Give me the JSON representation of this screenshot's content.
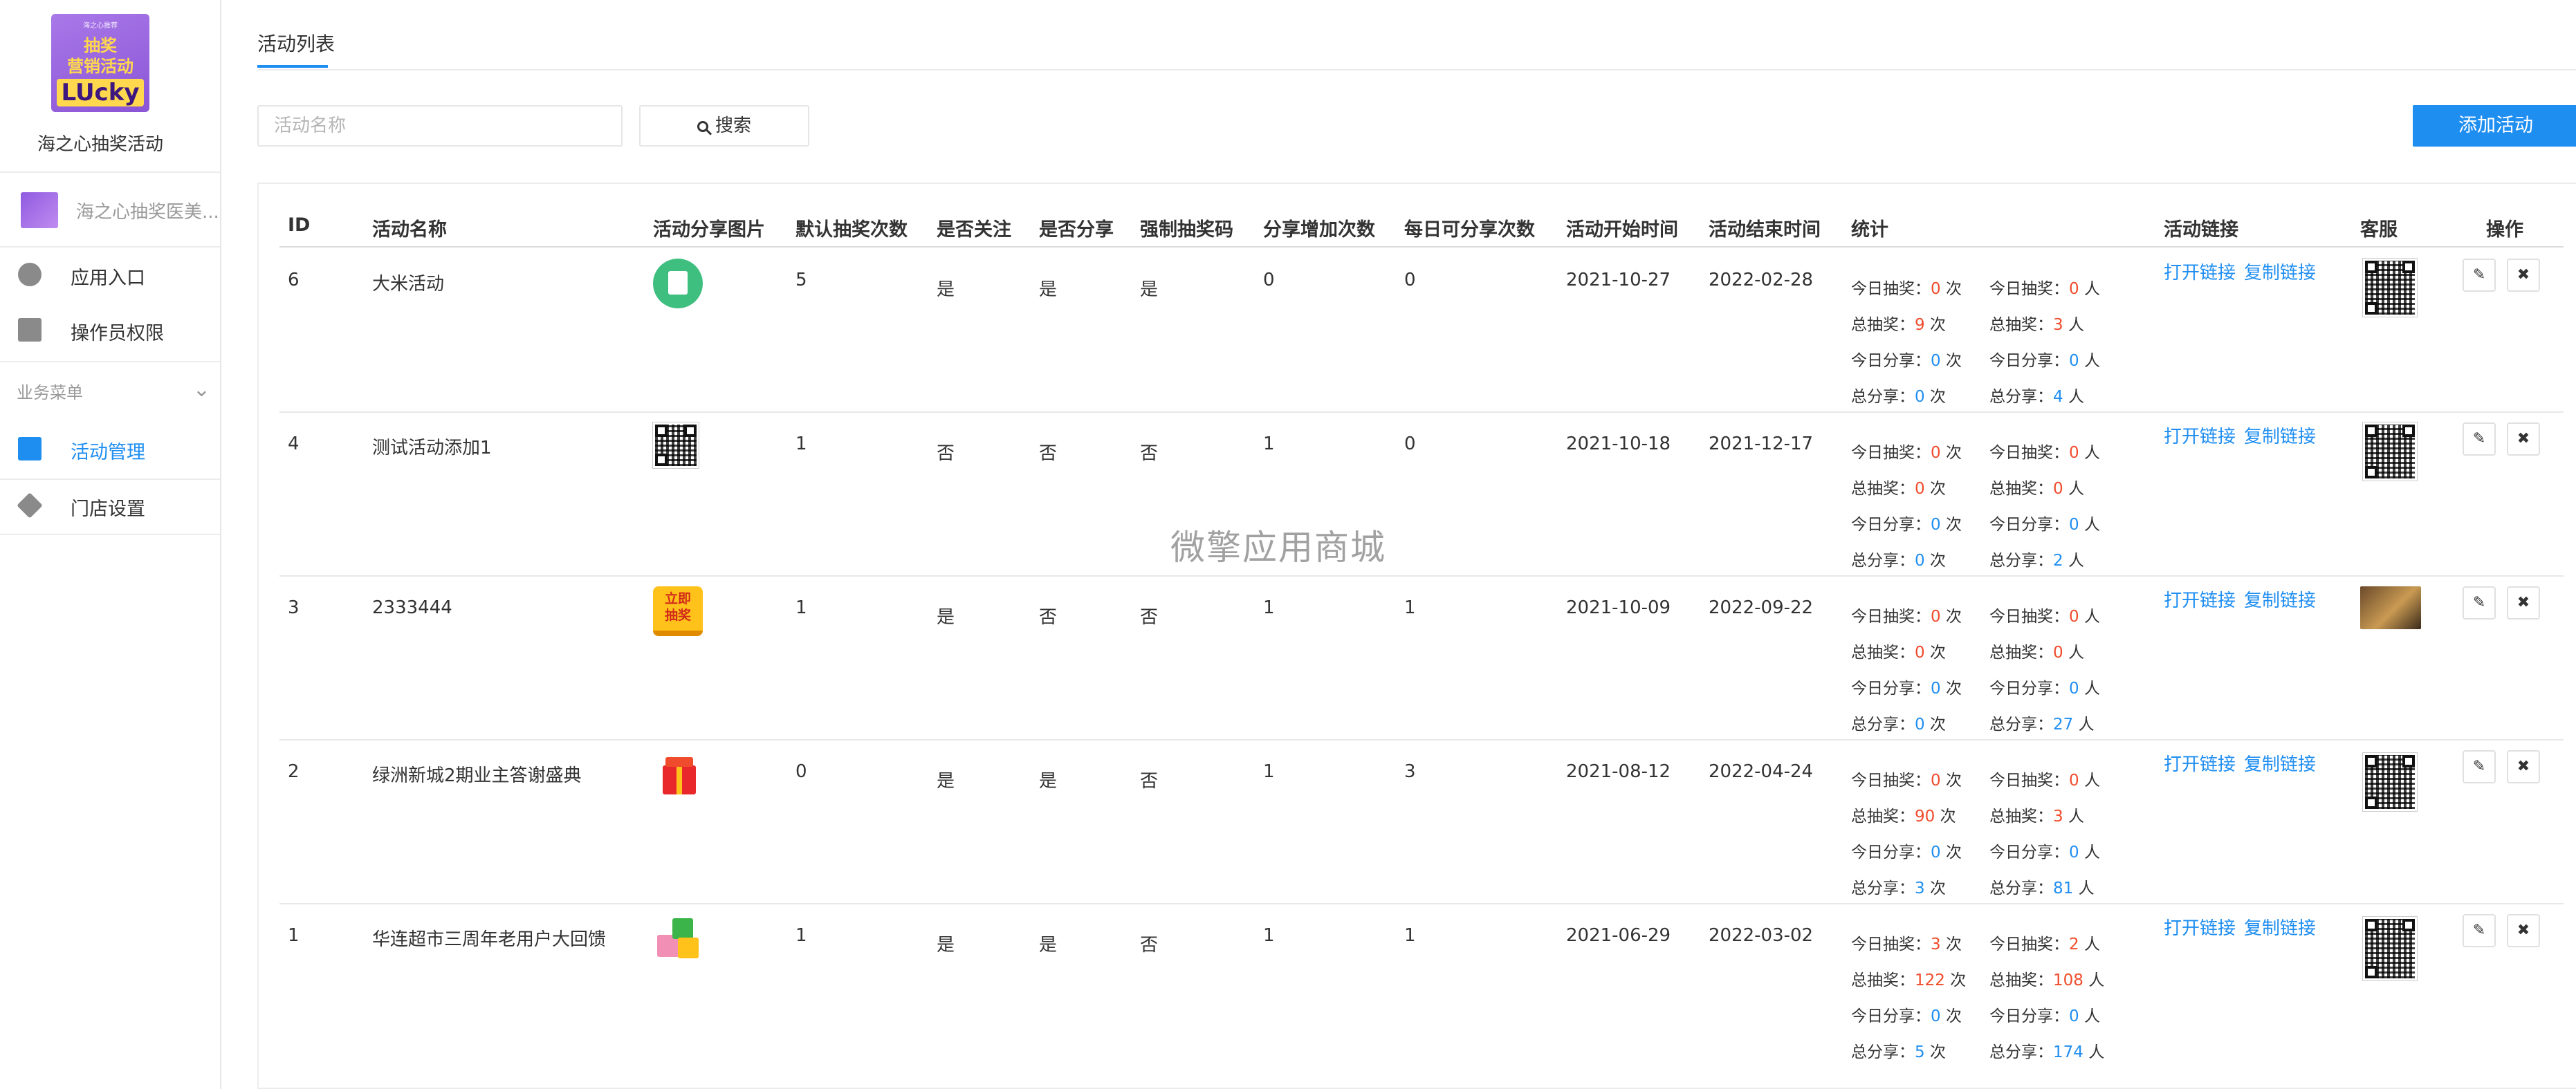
{
  "sidebar": {
    "logo": {
      "line1": "海之心推荐",
      "line2": "抽奖",
      "line3": "营销活动",
      "line4": "LUcky"
    },
    "app_name": "海之心抽奖活动",
    "store_name": "海之心抽奖医美...",
    "items": [
      {
        "label": "应用入口",
        "icon": "chat-icon"
      },
      {
        "label": "操作员权限",
        "icon": "edit-document-icon"
      }
    ],
    "section_label": "业务菜单",
    "section_items": [
      {
        "label": "活动管理",
        "icon": "list-icon",
        "active": true
      },
      {
        "label": "门店设置",
        "icon": "box-icon",
        "active": false
      }
    ]
  },
  "header": {
    "tab_title": "活动列表"
  },
  "search": {
    "placeholder": "活动名称",
    "button_label": "搜索"
  },
  "add_button_label": "添加活动",
  "table": {
    "columns": [
      "ID",
      "活动名称",
      "活动分享图片",
      "默认抽奖次数",
      "是否关注",
      "是否分享",
      "强制抽奖码",
      "分享增加次数",
      "每日可分享次数",
      "活动开始时间",
      "活动结束时间",
      "统计",
      "活动链接",
      "客服",
      "操作"
    ],
    "stat_labels": {
      "today_draw": "今日抽奖：",
      "total_draw": "总抽奖：",
      "today_share": "今日分享：",
      "total_share": "总分享：",
      "times_unit": " 次",
      "people_unit": " 人"
    },
    "link_labels": {
      "open": "打开链接",
      "copy": "复制链接"
    },
    "rows": [
      {
        "id": "6",
        "name": "大米活动",
        "image": "document-icon",
        "default_draws": "5",
        "follow": "是",
        "share": "是",
        "force_code": "是",
        "share_add": "0",
        "daily_share": "0",
        "start": "2021-10-27",
        "end": "2022-02-28",
        "stats": {
          "today_draw_times": "0",
          "today_draw_people": "0",
          "total_draw_times": "9",
          "total_draw_people": "3",
          "today_share_times": "0",
          "today_share_people": "0",
          "total_share_times": "0",
          "total_share_people": "4"
        }
      },
      {
        "id": "4",
        "name": "测试活动添加1",
        "image": "qr-icon",
        "default_draws": "1",
        "follow": "否",
        "share": "否",
        "force_code": "否",
        "share_add": "1",
        "daily_share": "0",
        "start": "2021-10-18",
        "end": "2021-12-17",
        "stats": {
          "today_draw_times": "0",
          "today_draw_people": "0",
          "total_draw_times": "0",
          "total_draw_people": "0",
          "today_share_times": "0",
          "today_share_people": "0",
          "total_share_times": "0",
          "total_share_people": "2"
        }
      },
      {
        "id": "3",
        "name": "2333444",
        "image": "draw-now-badge-icon",
        "image_text_1": "立即",
        "image_text_2": "抽奖",
        "default_draws": "1",
        "follow": "是",
        "share": "否",
        "force_code": "否",
        "share_add": "1",
        "daily_share": "1",
        "start": "2021-10-09",
        "end": "2022-09-22",
        "stats": {
          "today_draw_times": "0",
          "today_draw_people": "0",
          "total_draw_times": "0",
          "total_draw_people": "0",
          "today_share_times": "0",
          "today_share_people": "0",
          "total_share_times": "0",
          "total_share_people": "27"
        }
      },
      {
        "id": "2",
        "name": "绿洲新城2期业主答谢盛典",
        "image": "gift-box-icon",
        "default_draws": "0",
        "follow": "是",
        "share": "是",
        "force_code": "否",
        "share_add": "1",
        "daily_share": "3",
        "start": "2021-08-12",
        "end": "2022-04-24",
        "stats": {
          "today_draw_times": "0",
          "today_draw_people": "0",
          "total_draw_times": "90",
          "total_draw_people": "3",
          "today_share_times": "0",
          "today_share_people": "0",
          "total_share_times": "3",
          "total_share_people": "81"
        }
      },
      {
        "id": "1",
        "name": "华连超市三周年老用户大回馈",
        "image": "gifts-icon",
        "default_draws": "1",
        "follow": "是",
        "share": "是",
        "force_code": "否",
        "share_add": "1",
        "daily_share": "1",
        "start": "2021-06-29",
        "end": "2022-03-02",
        "stats": {
          "today_draw_times": "3",
          "today_draw_people": "2",
          "total_draw_times": "122",
          "total_draw_people": "108",
          "today_share_times": "0",
          "today_share_people": "0",
          "total_share_times": "5",
          "total_share_people": "174"
        }
      }
    ]
  },
  "watermark": "微擎应用商城",
  "colors": {
    "accent": "#1f8ef1",
    "highlight_red": "#f04b2c",
    "logo_purple": "#8a55d6"
  }
}
